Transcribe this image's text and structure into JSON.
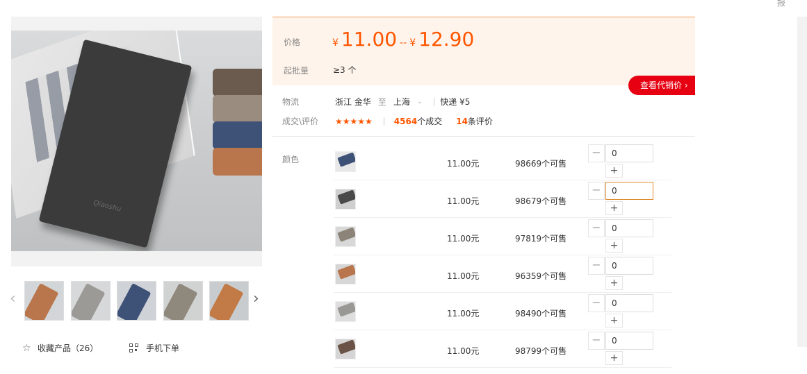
{
  "corner_text": "报",
  "gallery": {
    "main_image": "gray-wallet-photo",
    "prev_icon": "‹",
    "next_icon": "›",
    "thumbnails": [
      {
        "name": "brown-wallet",
        "color": "#b9764d",
        "bg": "#d3d6d8"
      },
      {
        "name": "gray-wallet",
        "color": "#9c9a96",
        "bg": "#d7d8d9"
      },
      {
        "name": "blue-wallet",
        "color": "#3e5278",
        "bg": "#cfd2d6"
      },
      {
        "name": "khaki-wallet",
        "color": "#8f887d",
        "bg": "#d1d2d2"
      },
      {
        "name": "open-brown-wallet",
        "color": "#c27b47",
        "bg": "#c9ccce"
      }
    ],
    "favorite_label": "收藏产品（26）",
    "mobile_label": "手机下单"
  },
  "price": {
    "label": "价格",
    "currency": "¥",
    "low": "11.00",
    "separator": "--",
    "high": "12.90",
    "moq_label": "起批量",
    "moq_value": "≥3 个"
  },
  "agent_button": "查看代销价 ›",
  "logistics": {
    "label": "物流",
    "from": "浙江 金华",
    "to_word": "至",
    "destination": "上海",
    "caret": "⌄",
    "shipping": "快递 ¥5"
  },
  "deal": {
    "label": "成交\\评价",
    "stars": "★★★★★",
    "rating": 4.5,
    "count": "4564",
    "count_unit": "个成交",
    "reviews": "14",
    "reviews_unit": "条评价"
  },
  "sku": {
    "label": "颜色",
    "minus": "−",
    "plus": "+",
    "rows": [
      {
        "swatch": "#3e5278",
        "bg": "#e8e8e8",
        "price": "11.00元",
        "stock": "98669个可售",
        "qty": "0",
        "focused": false
      },
      {
        "swatch": "#4a4a4a",
        "bg": "#cfcfcf",
        "price": "11.00元",
        "stock": "98679个可售",
        "qty": "0",
        "focused": true
      },
      {
        "swatch": "#8c8479",
        "bg": "#d8d8d8",
        "price": "11.00元",
        "stock": "97819个可售",
        "qty": "0",
        "focused": false
      },
      {
        "swatch": "#b9764d",
        "bg": "#d6d6d6",
        "price": "11.00元",
        "stock": "96359个可售",
        "qty": "0",
        "focused": false
      },
      {
        "swatch": "#9a9894",
        "bg": "#dedede",
        "price": "11.00元",
        "stock": "98490个可售",
        "qty": "0",
        "focused": false
      },
      {
        "swatch": "#6b5246",
        "bg": "#d5d5d5",
        "price": "11.00元",
        "stock": "98799个可售",
        "qty": "0",
        "focused": false
      }
    ]
  }
}
